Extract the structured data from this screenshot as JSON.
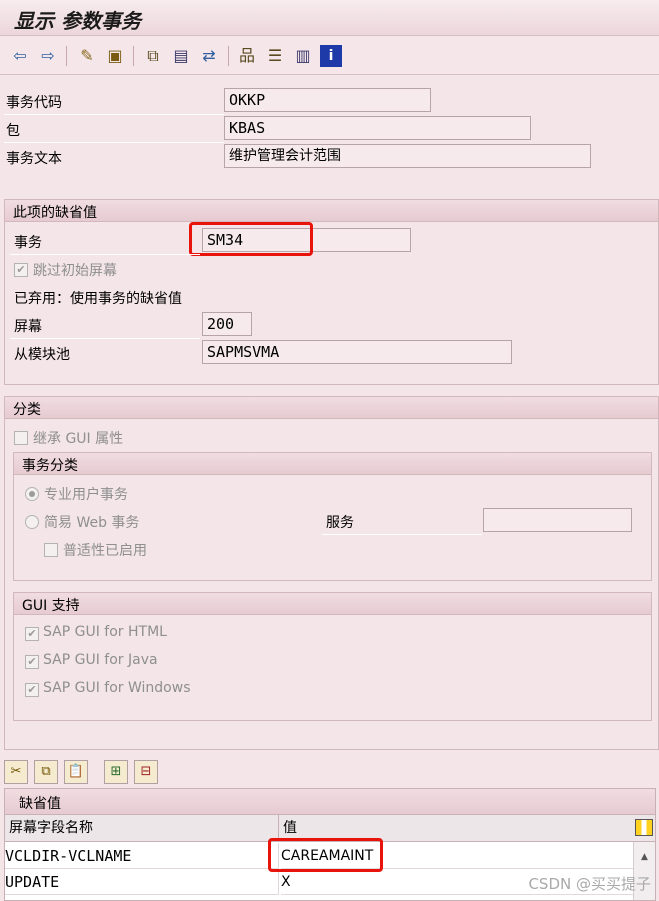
{
  "title": "显示 参数事务",
  "toolbar_icons": [
    "back-arrow-icon",
    "forward-arrow-icon",
    "edit-icon",
    "save-icon",
    "other-object-icon",
    "display-icon",
    "navigate-icon",
    "hierarchy-icon",
    "where-used-icon",
    "layout-icon",
    "info-icon"
  ],
  "header": {
    "tcode_label": "事务代码",
    "tcode_value": "OKKP",
    "package_label": "包",
    "package_value": "KBAS",
    "text_label": "事务文本",
    "text_value": "维护管理会计范围"
  },
  "defaults": {
    "section_title": "此项的缺省值",
    "transaction_label": "事务",
    "transaction_value": "SM34",
    "skip_initial_label": "跳过初始屏幕",
    "skip_initial_checked": true,
    "obsolete_label": "已弃用：使用事务的缺省值",
    "screen_label": "屏幕",
    "screen_value": "200",
    "module_pool_label": "从模块池",
    "module_pool_value": "SAPMSVMA"
  },
  "classification": {
    "section_title": "分类",
    "inherit_gui_label": "继承 GUI 属性",
    "tx_class_title": "事务分类",
    "professional_label": "专业用户事务",
    "easy_web_label": "简易 Web 事务",
    "service_label": "服务",
    "service_value": "",
    "pervasive_label": "普适性已启用",
    "gui_support_title": "GUI 支持",
    "gui_html_label": "SAP GUI for HTML",
    "gui_java_label": "SAP GUI for Java",
    "gui_windows_label": "SAP GUI for Windows"
  },
  "default_values": {
    "table_title": "缺省值",
    "columns": [
      "屏幕字段名称",
      "值"
    ],
    "rows": [
      {
        "field": "VCLDIR-VCLNAME",
        "value": "CAREAMAINT"
      },
      {
        "field": "UPDATE",
        "value": "X"
      }
    ]
  },
  "watermark": "CSDN @买买提子",
  "colors": {
    "highlight": "#e8140c",
    "background": "#f3e5e8"
  }
}
